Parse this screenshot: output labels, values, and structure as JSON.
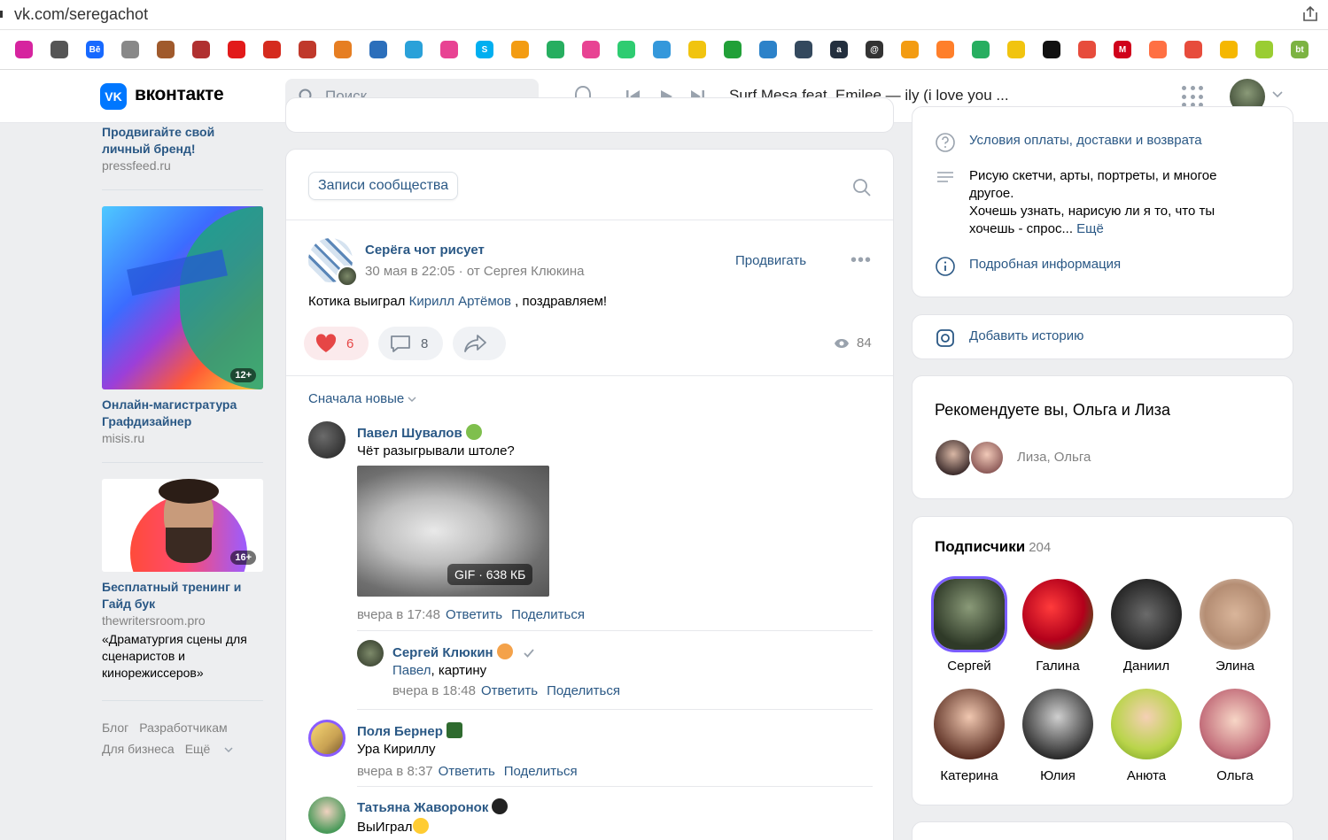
{
  "browser": {
    "url": "vk.com/seregachot"
  },
  "bookmarks": [
    {
      "icon": "instagram-icon",
      "color": "#d6249f"
    },
    {
      "icon": "globe-icon",
      "color": "#555555"
    },
    {
      "icon": "behance-icon",
      "color": "#1769ff",
      "label": "Bē"
    },
    {
      "icon": "mark-icon",
      "color": "#888888"
    },
    {
      "icon": "mark-icon",
      "color": "#a05a2c"
    },
    {
      "icon": "emblem-icon",
      "color": "#b03030"
    },
    {
      "icon": "rzd-icon",
      "color": "#e21a1a"
    },
    {
      "icon": "flag-icon",
      "color": "#d52b1e"
    },
    {
      "icon": "emblem-icon",
      "color": "#c0392b"
    },
    {
      "icon": "emblem-icon",
      "color": "#e67e22"
    },
    {
      "icon": "emblem-icon",
      "color": "#2c6fbb"
    },
    {
      "icon": "app-icon",
      "color": "#2aa1d9"
    },
    {
      "icon": "app-icon",
      "color": "#e84393"
    },
    {
      "icon": "skype-icon",
      "color": "#00aff0",
      "label": "S"
    },
    {
      "icon": "app-icon",
      "color": "#f39c12"
    },
    {
      "icon": "app-icon",
      "color": "#27ae60"
    },
    {
      "icon": "app-icon",
      "color": "#e84393"
    },
    {
      "icon": "app-icon",
      "color": "#2ecc71"
    },
    {
      "icon": "app-icon",
      "color": "#3498db"
    },
    {
      "icon": "app-icon",
      "color": "#f1c40f"
    },
    {
      "icon": "sber-icon",
      "color": "#21a038"
    },
    {
      "icon": "app-icon",
      "color": "#2c82c9"
    },
    {
      "icon": "app-icon",
      "color": "#34495e"
    },
    {
      "icon": "amazon-icon",
      "color": "#232f3e",
      "label": "a"
    },
    {
      "icon": "at-icon",
      "color": "#333333",
      "label": "@"
    },
    {
      "icon": "app-icon",
      "color": "#f39c12"
    },
    {
      "icon": "app-icon",
      "color": "#ff7f2a"
    },
    {
      "icon": "app-icon",
      "color": "#27ae60"
    },
    {
      "icon": "app-icon",
      "color": "#f1c40f"
    },
    {
      "icon": "app-icon",
      "color": "#111111"
    },
    {
      "icon": "app-icon",
      "color": "#e74c3c"
    },
    {
      "icon": "metro-icon",
      "color": "#d0021b",
      "label": "M"
    },
    {
      "icon": "app-icon",
      "color": "#ff7043"
    },
    {
      "icon": "app-icon",
      "color": "#e74c3c"
    },
    {
      "icon": "app-icon",
      "color": "#f5b700"
    },
    {
      "icon": "app-icon",
      "color": "#9acd32"
    },
    {
      "icon": "app-icon",
      "color": "#7cb342",
      "label": "bt"
    }
  ],
  "header": {
    "logo_text": "вконтакте",
    "search_placeholder": "Поиск",
    "now_playing": "Surf Mesa feat. Emilee — ily (i love you ..."
  },
  "ads": [
    {
      "title": "Продвигайте свой личный бренд!",
      "domain": "pressfeed.ru"
    },
    {
      "title": "Онлайн-магистратура Графдизайнер",
      "domain": "misis.ru",
      "age": "12+"
    },
    {
      "title": "Бесплатный тренинг и Гайд бук",
      "domain": "thewritersroom.pro",
      "text": "«Драматургия сцены для сценаристов и кинорежиссеров»",
      "age": "16+"
    }
  ],
  "footer": {
    "links": [
      "Блог",
      "Разработчикам",
      "Для бизнеса",
      "Ещё"
    ]
  },
  "wall": {
    "tab_label": "Записи сообщества",
    "post": {
      "author": "Серёга чот рисует",
      "date": "30 мая в 22:05",
      "signer": "от Сергея Клюкина",
      "promote": "Продвигать",
      "text_before": "Котика выиграл ",
      "mention": "Кирилл Артёмов",
      "text_after": " , поздравляем!",
      "likes": "6",
      "comments": "8",
      "views": "84"
    },
    "sort_label": "Сначала новые",
    "comments": [
      {
        "author": "Павел Шувалов",
        "text": "Чёт разыгрывали штоле?",
        "gif_label": "GIF · 638 КБ",
        "time": "вчера в 17:48",
        "reply": "Ответить",
        "share": "Поделиться"
      },
      {
        "author": "Сергей Клюкин",
        "reply_to": "Павел",
        "text": ", картину",
        "time": "вчера в 18:48",
        "reply": "Ответить",
        "share": "Поделиться"
      },
      {
        "author": "Поля Бернер",
        "text": "Ура Кириллу",
        "time": "вчера в 8:37",
        "reply": "Ответить",
        "share": "Поделиться"
      },
      {
        "author": "Татьяна Жаворонок",
        "text": "ВыИграл"
      }
    ]
  },
  "right": {
    "info": {
      "terms": "Условия оплаты, доставки и возврата",
      "desc1": "Рисую скетчи, арты, портреты, и многое",
      "desc2": "другое.",
      "desc3": "Хочешь узнать, нарисую ли я то, что ты",
      "desc4": "хочешь - спрос...",
      "more": "Ещё",
      "details": "Подробная информация"
    },
    "story": "Добавить историю",
    "recommend": {
      "title": "Рекомендуете вы, Ольга и Лиза",
      "names": "Лиза, Ольга"
    },
    "subscribers": {
      "title": "Подписчики",
      "count": "204",
      "people": [
        "Сергей",
        "Галина",
        "Даниил",
        "Элина",
        "Катерина",
        "Юлия",
        "Анюта",
        "Ольга"
      ]
    }
  }
}
